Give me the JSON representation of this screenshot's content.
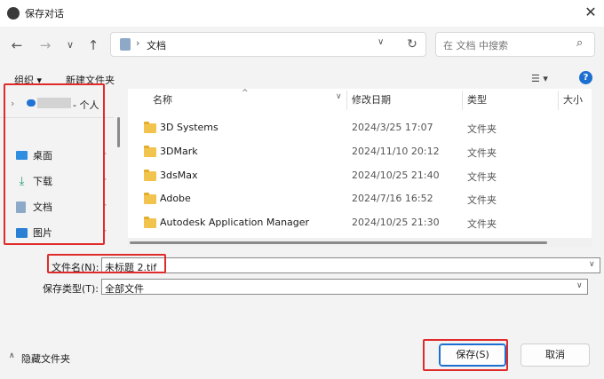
{
  "window": {
    "title": "保存对话"
  },
  "nav": {
    "back": "←",
    "forward": "→",
    "down": "∨",
    "up": "↑",
    "refresh": "↻"
  },
  "address": {
    "location": "文档",
    "chevron": "›"
  },
  "search": {
    "placeholder": "在 文档 中搜索"
  },
  "toolbar": {
    "organize": "组织 ▾",
    "new_folder": "新建文件夹",
    "view": "☰ ▾",
    "help": "?"
  },
  "sidebar": {
    "account_suffix": "- 个人",
    "items": [
      {
        "label": "桌面",
        "icon": "desktop-icon"
      },
      {
        "label": "下载",
        "icon": "download-icon"
      },
      {
        "label": "文档",
        "icon": "documents-icon"
      },
      {
        "label": "图片",
        "icon": "pictures-icon"
      }
    ]
  },
  "columns": {
    "name": "名称",
    "modified": "修改日期",
    "type": "类型",
    "size": "大小"
  },
  "files": [
    {
      "name": "3D Systems",
      "modified": "2024/3/25 17:07",
      "type": "文件夹"
    },
    {
      "name": "3DMark",
      "modified": "2024/11/10 20:12",
      "type": "文件夹"
    },
    {
      "name": "3dsMax",
      "modified": "2024/10/25 21:40",
      "type": "文件夹"
    },
    {
      "name": "Adobe",
      "modified": "2024/7/16 16:52",
      "type": "文件夹"
    },
    {
      "name": "Autodesk Application Manager",
      "modified": "2024/10/25 21:30",
      "type": "文件夹"
    }
  ],
  "filename": {
    "label": "文件名(N):",
    "value": "未标题 2.tif"
  },
  "filetype": {
    "label": "保存类型(T):",
    "value": "全部文件"
  },
  "footer": {
    "hide_folders": "隐藏文件夹",
    "save": "保存(S)",
    "cancel": "取消"
  }
}
